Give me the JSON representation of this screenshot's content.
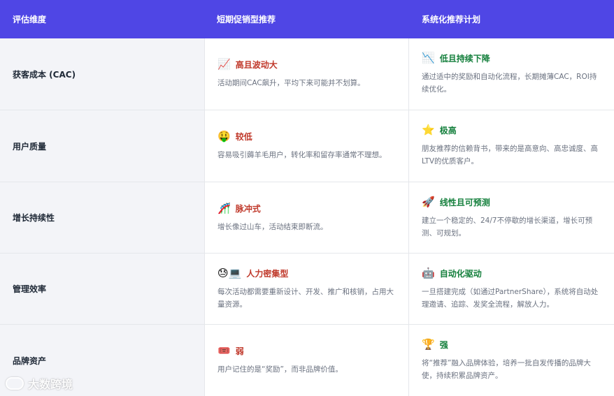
{
  "header": {
    "col1": "评估维度",
    "col2": "短期促销型推荐",
    "col3": "系统化推荐计划"
  },
  "rows": [
    {
      "dimension": "获客成本 (CAC)",
      "short": {
        "icon": "📈",
        "icon_name": "chart-up-icon",
        "title": "高且波动大",
        "desc": "活动期间CAC飙升，平均下来可能并不划算。"
      },
      "system": {
        "icon": "📉",
        "icon_name": "chart-down-icon",
        "title": "低且持续下降",
        "desc": "通过适中的奖励和自动化流程，长期摊薄CAC，ROI持续优化。"
      }
    },
    {
      "dimension": "用户质量",
      "short": {
        "icon": "🤑",
        "icon_name": "money-face-icon",
        "title": "较低",
        "desc": "容易吸引薅羊毛用户，转化率和留存率通常不理想。"
      },
      "system": {
        "icon": "⭐",
        "icon_name": "star-icon",
        "title": "极高",
        "desc": "朋友推荐的信赖背书，带来的是高意向、高忠诚度、高LTV的优质客户。"
      }
    },
    {
      "dimension": "增长持续性",
      "short": {
        "icon": "🎢",
        "icon_name": "roller-coaster-icon",
        "title": "脉冲式",
        "desc": "增长像过山车，活动结束即断流。"
      },
      "system": {
        "icon": "🚀",
        "icon_name": "rocket-icon",
        "title": "线性且可预测",
        "desc": "建立一个稳定的、24/7不停歇的增长渠道，增长可预测、可规划。"
      }
    },
    {
      "dimension": "管理效率",
      "short": {
        "icon": "😓💻",
        "icon_name": "tired-laptop-icon",
        "title": "人力密集型",
        "desc": "每次活动都需要重新设计、开发、推广和核销，占用大量资源。"
      },
      "system": {
        "icon": "🤖",
        "icon_name": "robot-icon",
        "title": "自动化驱动",
        "desc": "一旦搭建完成（如通过PartnerShare），系统将自动处理邀请、追踪、发奖全流程，解放人力。"
      }
    },
    {
      "dimension": "品牌资产",
      "short": {
        "icon": "🎟️",
        "icon_name": "ticket-icon",
        "title": "弱",
        "desc": "用户记住的是“奖励”，而非品牌价值。"
      },
      "system": {
        "icon": "🏆",
        "icon_name": "trophy-icon",
        "title": "强",
        "desc": "将“推荐”融入品牌体验，培养一批自发传播的品牌大使，持续积累品牌资产。"
      }
    }
  ],
  "watermark": {
    "text": "大数跨境"
  }
}
